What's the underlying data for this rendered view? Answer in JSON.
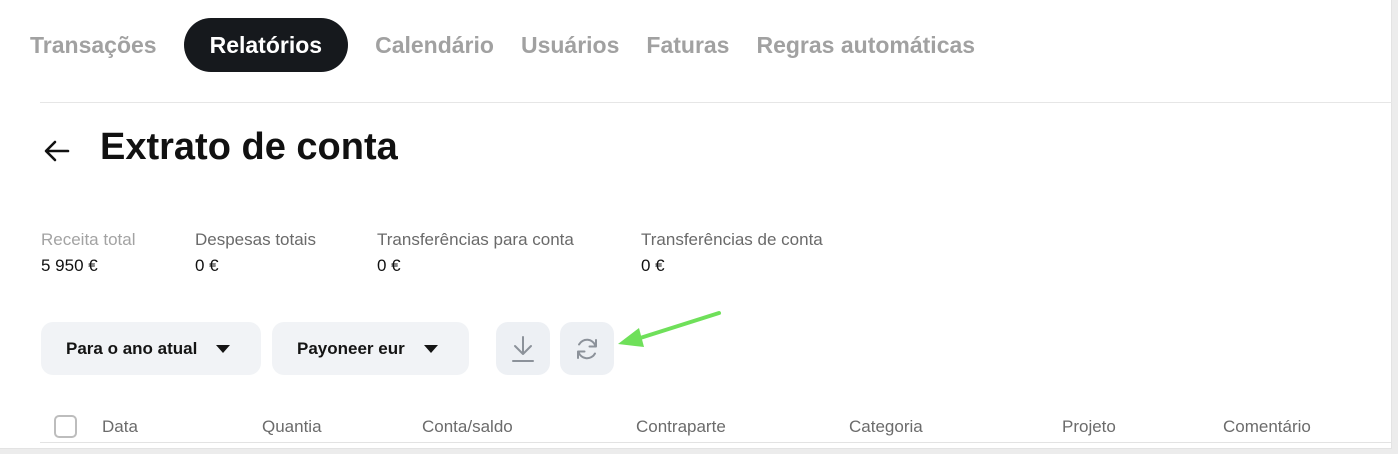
{
  "nav": {
    "tabs": [
      {
        "label": "Transações",
        "active": false
      },
      {
        "label": "Relatórios",
        "active": true
      },
      {
        "label": "Calendário",
        "active": false
      },
      {
        "label": "Usuários",
        "active": false
      },
      {
        "label": "Faturas",
        "active": false
      },
      {
        "label": "Regras automáticas",
        "active": false
      }
    ]
  },
  "header": {
    "back_icon": "arrow-left-icon",
    "title": "Extrato de conta"
  },
  "stats": [
    {
      "label": "Receita total",
      "value": "5 950 €"
    },
    {
      "label": "Despesas totais",
      "value": "0 €"
    },
    {
      "label": "Transferências para conta",
      "value": "0 €"
    },
    {
      "label": "Transferências de conta",
      "value": "0 €"
    }
  ],
  "filters": {
    "period": {
      "selected": "Para o ano atual"
    },
    "account": {
      "selected": "Payoneer eur"
    }
  },
  "actions": {
    "download_icon": "download-icon",
    "refresh_icon": "refresh-icon",
    "annotation_color": "#6fe05a"
  },
  "table": {
    "columns": [
      "Data",
      "Quantia",
      "Conta/saldo",
      "Contraparte",
      "Categoria",
      "Projeto",
      "Comentário"
    ]
  },
  "colors": {
    "active_tab_bg": "#16191d",
    "inactive_tab": "#a1a1a1",
    "control_bg": "#f1f3f6"
  }
}
